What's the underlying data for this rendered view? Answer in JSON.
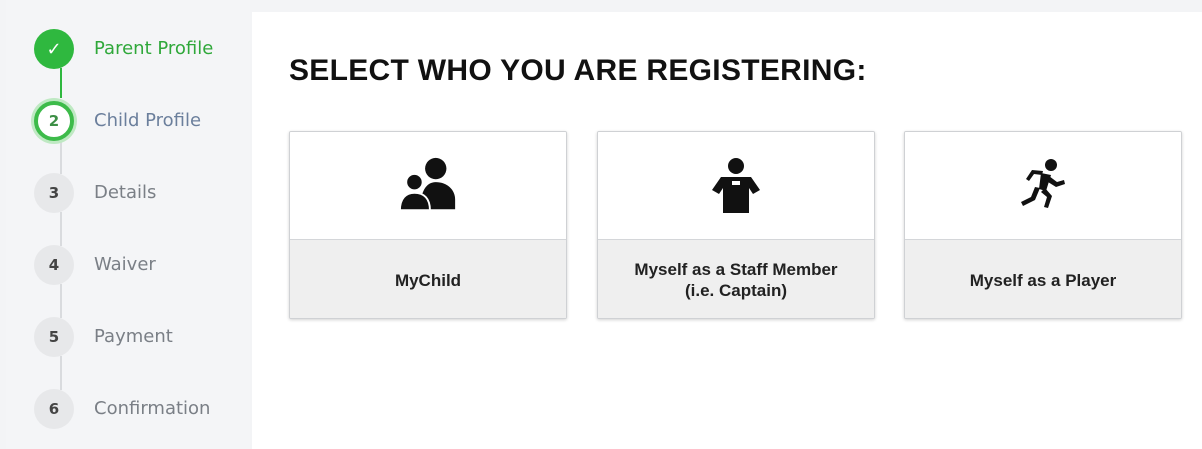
{
  "stepper": {
    "steps": [
      {
        "number": "✓",
        "label": "Parent Profile",
        "state": "done"
      },
      {
        "number": "2",
        "label": "Child Profile",
        "state": "active"
      },
      {
        "number": "3",
        "label": "Details",
        "state": "pending"
      },
      {
        "number": "4",
        "label": "Waiver",
        "state": "pending"
      },
      {
        "number": "5",
        "label": "Payment",
        "state": "pending"
      },
      {
        "number": "6",
        "label": "Confirmation",
        "state": "pending"
      }
    ]
  },
  "main": {
    "title": "SELECT WHO YOU ARE REGISTERING:",
    "options": [
      {
        "label": "MyChild",
        "icon": "parent-child-icon"
      },
      {
        "label": "Myself as a Staff Member\n(i.e. Captain)",
        "icon": "staff-member-icon"
      },
      {
        "label": "Myself as a Player",
        "icon": "running-player-icon"
      }
    ]
  },
  "colors": {
    "accent_green": "#2fb83f",
    "inactive_step": "#e7e8ea",
    "card_caption_bg": "#efefef"
  }
}
